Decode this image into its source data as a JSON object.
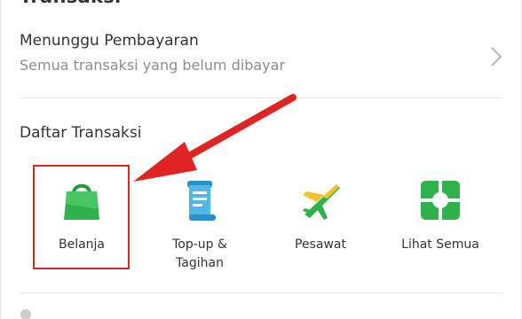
{
  "header": {
    "title": "Transaksi"
  },
  "pending_payment": {
    "title": "Menunggu Pembayaran",
    "subtitle": "Semua transaksi yang belum dibayar"
  },
  "transaction_list": {
    "heading": "Daftar Transaksi",
    "items": [
      {
        "label": "Belanja",
        "icon": "shopping-bag-icon",
        "color": "#2fb24c"
      },
      {
        "label": "Top-up & Tagihan",
        "icon": "receipt-icon",
        "color": "#35a7e0"
      },
      {
        "label": "Pesawat",
        "icon": "airplane-icon",
        "color": "#2fb24c"
      },
      {
        "label": "Lihat Semua",
        "icon": "grid-icon",
        "color": "#2fb24c"
      }
    ]
  },
  "annotation": {
    "color": "#e02424"
  }
}
